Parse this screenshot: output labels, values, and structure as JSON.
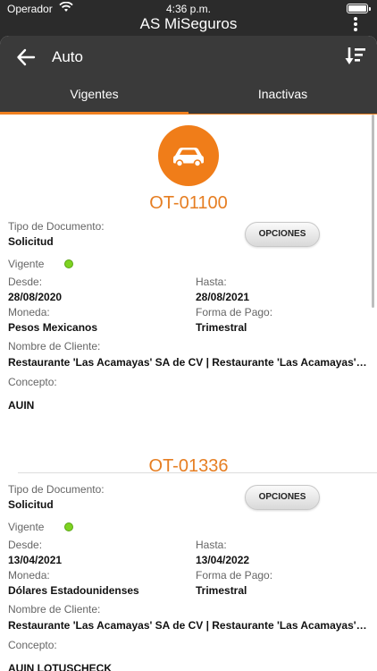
{
  "status": {
    "carrier": "Operador",
    "time": "4:36 p.m."
  },
  "app": {
    "title": "AS MiSeguros"
  },
  "nav": {
    "title": "Auto"
  },
  "tabs": [
    {
      "label": "Vigentes"
    },
    {
      "label": "Inactivas"
    }
  ],
  "labels": {
    "tipo": "Tipo de Documento:",
    "vigente": "Vigente",
    "desde": "Desde:",
    "hasta": "Hasta:",
    "moneda": "Moneda:",
    "forma": "Forma de Pago:",
    "cliente": "Nombre de Cliente:",
    "concepto": "Concepto:",
    "opciones": "OPCIONES"
  },
  "cards": [
    {
      "ot": "OT-01100",
      "tipo": "Solicitud",
      "desde": "28/08/2020",
      "hasta": "28/08/2021",
      "moneda": "Pesos Mexicanos",
      "forma": "Trimestral",
      "cliente": "Restaurante 'Las Acamayas' SA de CV | Restaurante 'Las Acamayas' SA de CV",
      "concepto": "AUIN"
    },
    {
      "ot": "OT-01336",
      "tipo": "Solicitud",
      "desde": "13/04/2021",
      "hasta": "13/04/2022",
      "moneda": "Dólares Estadounidenses",
      "forma": "Trimestral",
      "cliente": "Restaurante 'Las Acamayas' SA de CV | Restaurante 'Las Acamayas' SA de CV",
      "concepto": "AUIN LOTUSCHECK"
    }
  ],
  "colors": {
    "accent": "#f0801f",
    "vigente_dot": "#7ed321"
  }
}
